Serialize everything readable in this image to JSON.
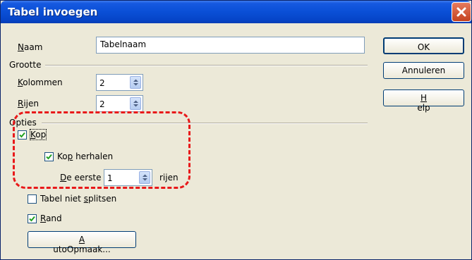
{
  "window": {
    "title": "Tabel invoegen"
  },
  "fields": {
    "naam_label": "Naam",
    "naam_value": "Tabelnaam",
    "grootte_label": "Grootte",
    "kolommen_label": "Kolommen",
    "kolommen_value": "2",
    "rijen_label": "Rijen",
    "rijen_value": "2"
  },
  "options": {
    "opties_label": "Opties",
    "kop_label": "Kop",
    "kop_checked": true,
    "kop_herhalen_label": "Kop herhalen",
    "kop_herhalen_checked": true,
    "de_eerste_label": "De eerste",
    "de_eerste_value": "1",
    "rijen_suffix": "rijen",
    "tabel_niet_splitsen_label": "Tabel niet splitsen",
    "tabel_niet_splitsen_checked": false,
    "rand_label": "Rand",
    "rand_checked": true
  },
  "buttons": {
    "ok": "OK",
    "annuleren": "Annuleren",
    "help": "Help",
    "autoopmaak": "AutoOpmaak..."
  },
  "colors": {
    "annotation": "#e8191a",
    "titlebar": "#0a4fd6"
  }
}
